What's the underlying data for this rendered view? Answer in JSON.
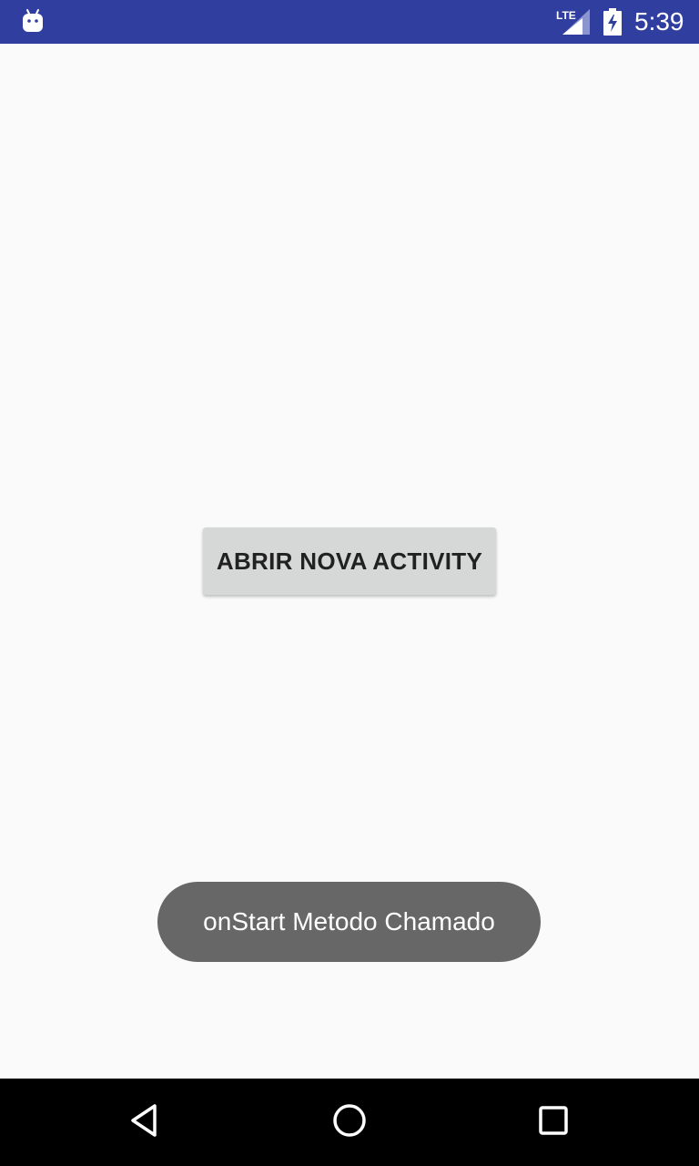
{
  "status_bar": {
    "network_label": "LTE",
    "time": "5:39",
    "background_color": "#303f9f",
    "icons": [
      "android-debug-icon",
      "lte-signal-icon",
      "battery-charging-icon"
    ]
  },
  "main": {
    "open_activity_button_label": "ABRIR NOVA ACTIVITY"
  },
  "toast": {
    "message": "onStart Metodo Chamado"
  },
  "nav_bar": {
    "icons": [
      "back-icon",
      "home-icon",
      "recents-icon"
    ]
  }
}
